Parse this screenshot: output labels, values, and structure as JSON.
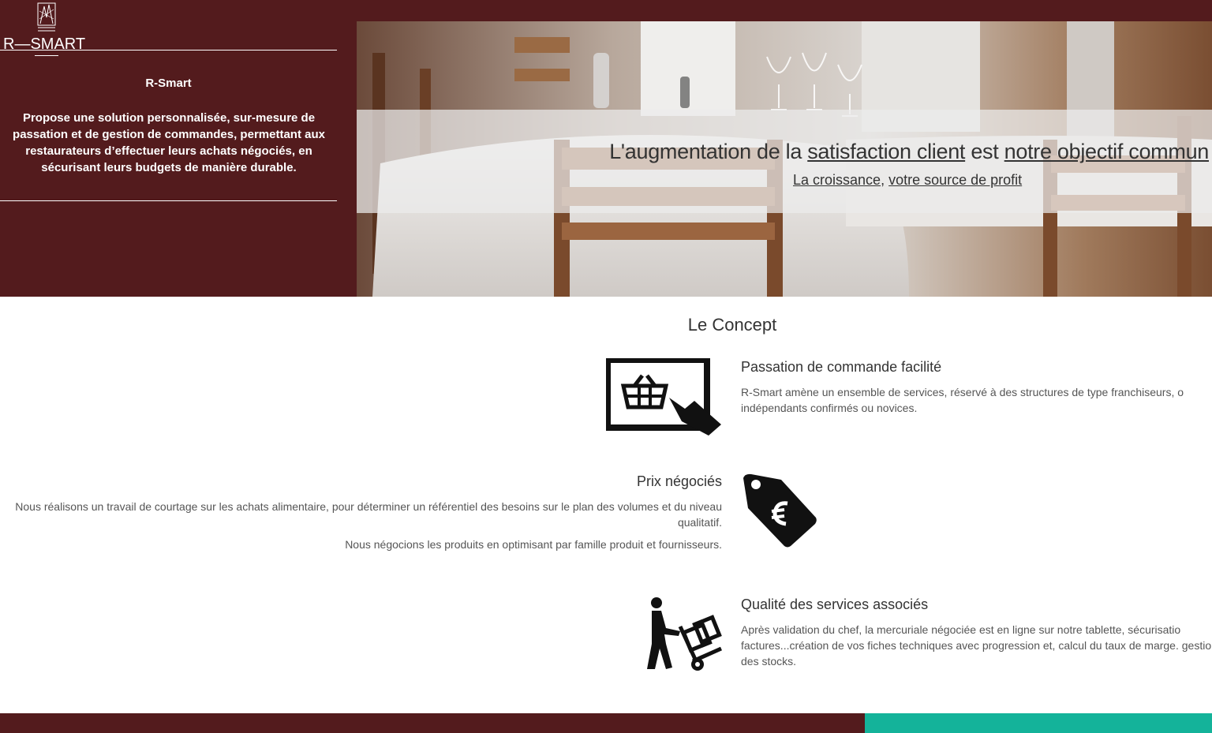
{
  "brand": {
    "logo_text": "R—SMART"
  },
  "intro": {
    "title": "R-Smart",
    "body": "Propose une solution personnalisée, sur-mesure de passation et de gestion de commandes, permettant aux restaurateurs d’effectuer leurs achats négociés, en sécurisant leurs budgets de manière durable."
  },
  "hero": {
    "tagline_part1": "L'augmentation de la ",
    "tagline_link1": "satisfaction client",
    "tagline_part2": " est ",
    "tagline_link2": "notre objectif commun",
    "sub_link1": "La croissance",
    "sub_sep": ", ",
    "sub_link2": "votre source de profit"
  },
  "concept": {
    "title": "Le Concept",
    "items": [
      {
        "title": "Passation de commande facilité",
        "text": "R-Smart amène un ensemble de services, réservé à des structures de type franchiseurs, o indépendants confirmés ou novices.",
        "icon": "shopping-basket-screen-icon"
      },
      {
        "title": "Prix négociés",
        "text1": "Nous réalisons un travail de courtage sur les achats alimentaire, pour déterminer un référentiel des besoins sur le plan des volumes et du niveau qualitatif.",
        "text2": "Nous négocions les produits en optimisant par famille produit et fournisseurs.",
        "icon": "euro-price-tag-icon"
      },
      {
        "title": "Qualité des services associés",
        "text": "Après validation du chef, la mercuriale négociée est en ligne sur notre tablette, sécurisatio factures...création de vos fiches techniques avec progression et, calcul du taux de marge. gestion des stocks.",
        "icon": "delivery-hand-truck-icon"
      }
    ]
  },
  "colors": {
    "brand": "#531b1d",
    "accent": "#14b39a"
  }
}
